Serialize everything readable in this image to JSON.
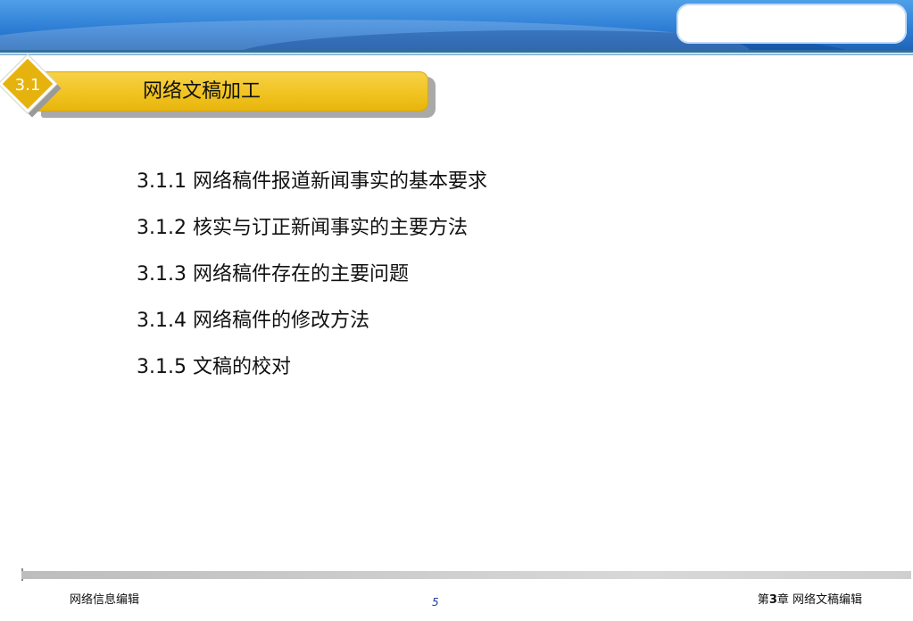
{
  "section": {
    "number": "3.1",
    "title": "网络文稿加工"
  },
  "items": [
    "3.1.1 网络稿件报道新闻事实的基本要求",
    "3.1.2 核实与订正新闻事实的主要方法",
    "3.1.3 网络稿件存在的主要问题",
    "3.1.4 网络稿件的修改方法",
    "3.1.5 文稿的校对"
  ],
  "footer": {
    "left": "网络信息编辑",
    "page": "5",
    "right_prefix": "第",
    "right_chapter": "3",
    "right_suffix": "章 网络文稿编辑"
  },
  "colors": {
    "banner": "#2f7fd6",
    "section_bar": "#f0c21d",
    "page_number": "#1f3f9e"
  }
}
